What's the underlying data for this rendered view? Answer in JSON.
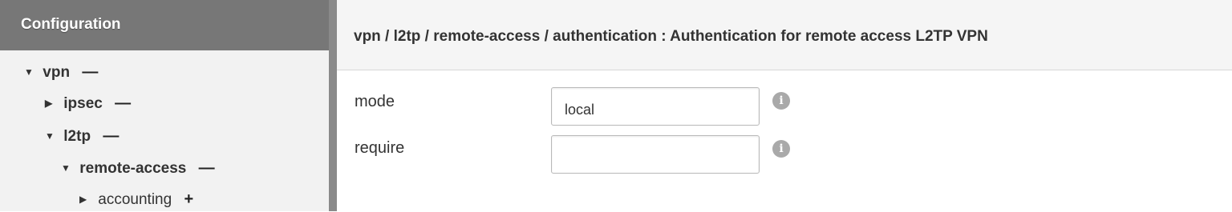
{
  "sidebar": {
    "title": "Configuration",
    "tree": [
      {
        "label": "vpn",
        "sign": "—",
        "caret": "▼"
      },
      {
        "label": "ipsec",
        "sign": "—",
        "caret": "▶"
      },
      {
        "label": "l2tp",
        "sign": "—",
        "caret": "▼"
      },
      {
        "label": "remote-access",
        "sign": "—",
        "caret": "▼"
      },
      {
        "label": "accounting",
        "sign": "+",
        "caret": "▶"
      }
    ]
  },
  "main": {
    "header": "vpn / l2tp / remote-access / authentication : Authentication for remote access L2TP VPN",
    "fields": [
      {
        "label": "mode",
        "value": "local",
        "info_icon": "info-icon"
      },
      {
        "label": "require",
        "value": "",
        "info_icon": "info-icon"
      }
    ]
  }
}
